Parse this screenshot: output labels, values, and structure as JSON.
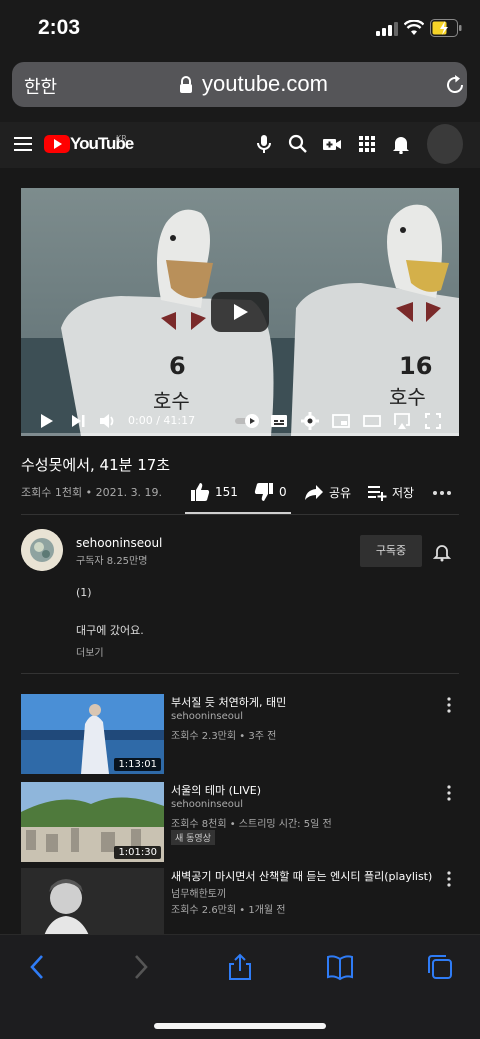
{
  "status_bar": {
    "time": "2:03"
  },
  "address_bar": {
    "reader_label": "한한",
    "url": "youtube.com"
  },
  "header": {
    "logo_text": "YouTube",
    "region": "KR"
  },
  "video": {
    "timecode": "0:00 / 41:17",
    "progress": 0
  },
  "title": "수성못에서, 41분 17초",
  "meta": "조회수 1천회 • 2021. 3. 19.",
  "actions": {
    "likes": "151",
    "dislikes": "0",
    "share": "공유",
    "save": "저장"
  },
  "channel": {
    "name": "sehooninseoul",
    "subscribers": "구독자 8.25만명",
    "subscribe_label": "구독중"
  },
  "description": {
    "line1": "(1)",
    "line2": "대구에 갔어요.",
    "more": "더보기"
  },
  "recommended": [
    {
      "title": "부서질 듯 처연하게, 태민",
      "channel": "sehooninseoul",
      "meta": "조회수 2.3만회 • 3주 전",
      "duration": "1:13:01",
      "badge": ""
    },
    {
      "title": "서울의 테마 (LIVE)",
      "channel": "sehooninseoul",
      "meta": "조회수 8천회 • 스트리밍 시간: 5일 전",
      "duration": "1:01:30",
      "badge": "새 동영상"
    },
    {
      "title": "새벽공기 마시면서 산책할 때 듣는 엔시티 플리(playlist)",
      "channel": "넘무해한토끼",
      "meta": "조회수 2.6만회 • 1개월 전",
      "duration": "",
      "badge": ""
    }
  ],
  "colors": {
    "youtube_red": "#ff0000",
    "background": "#181818",
    "safari_blue": "#2f7cf6",
    "battery_yellow": "#f5d328"
  }
}
